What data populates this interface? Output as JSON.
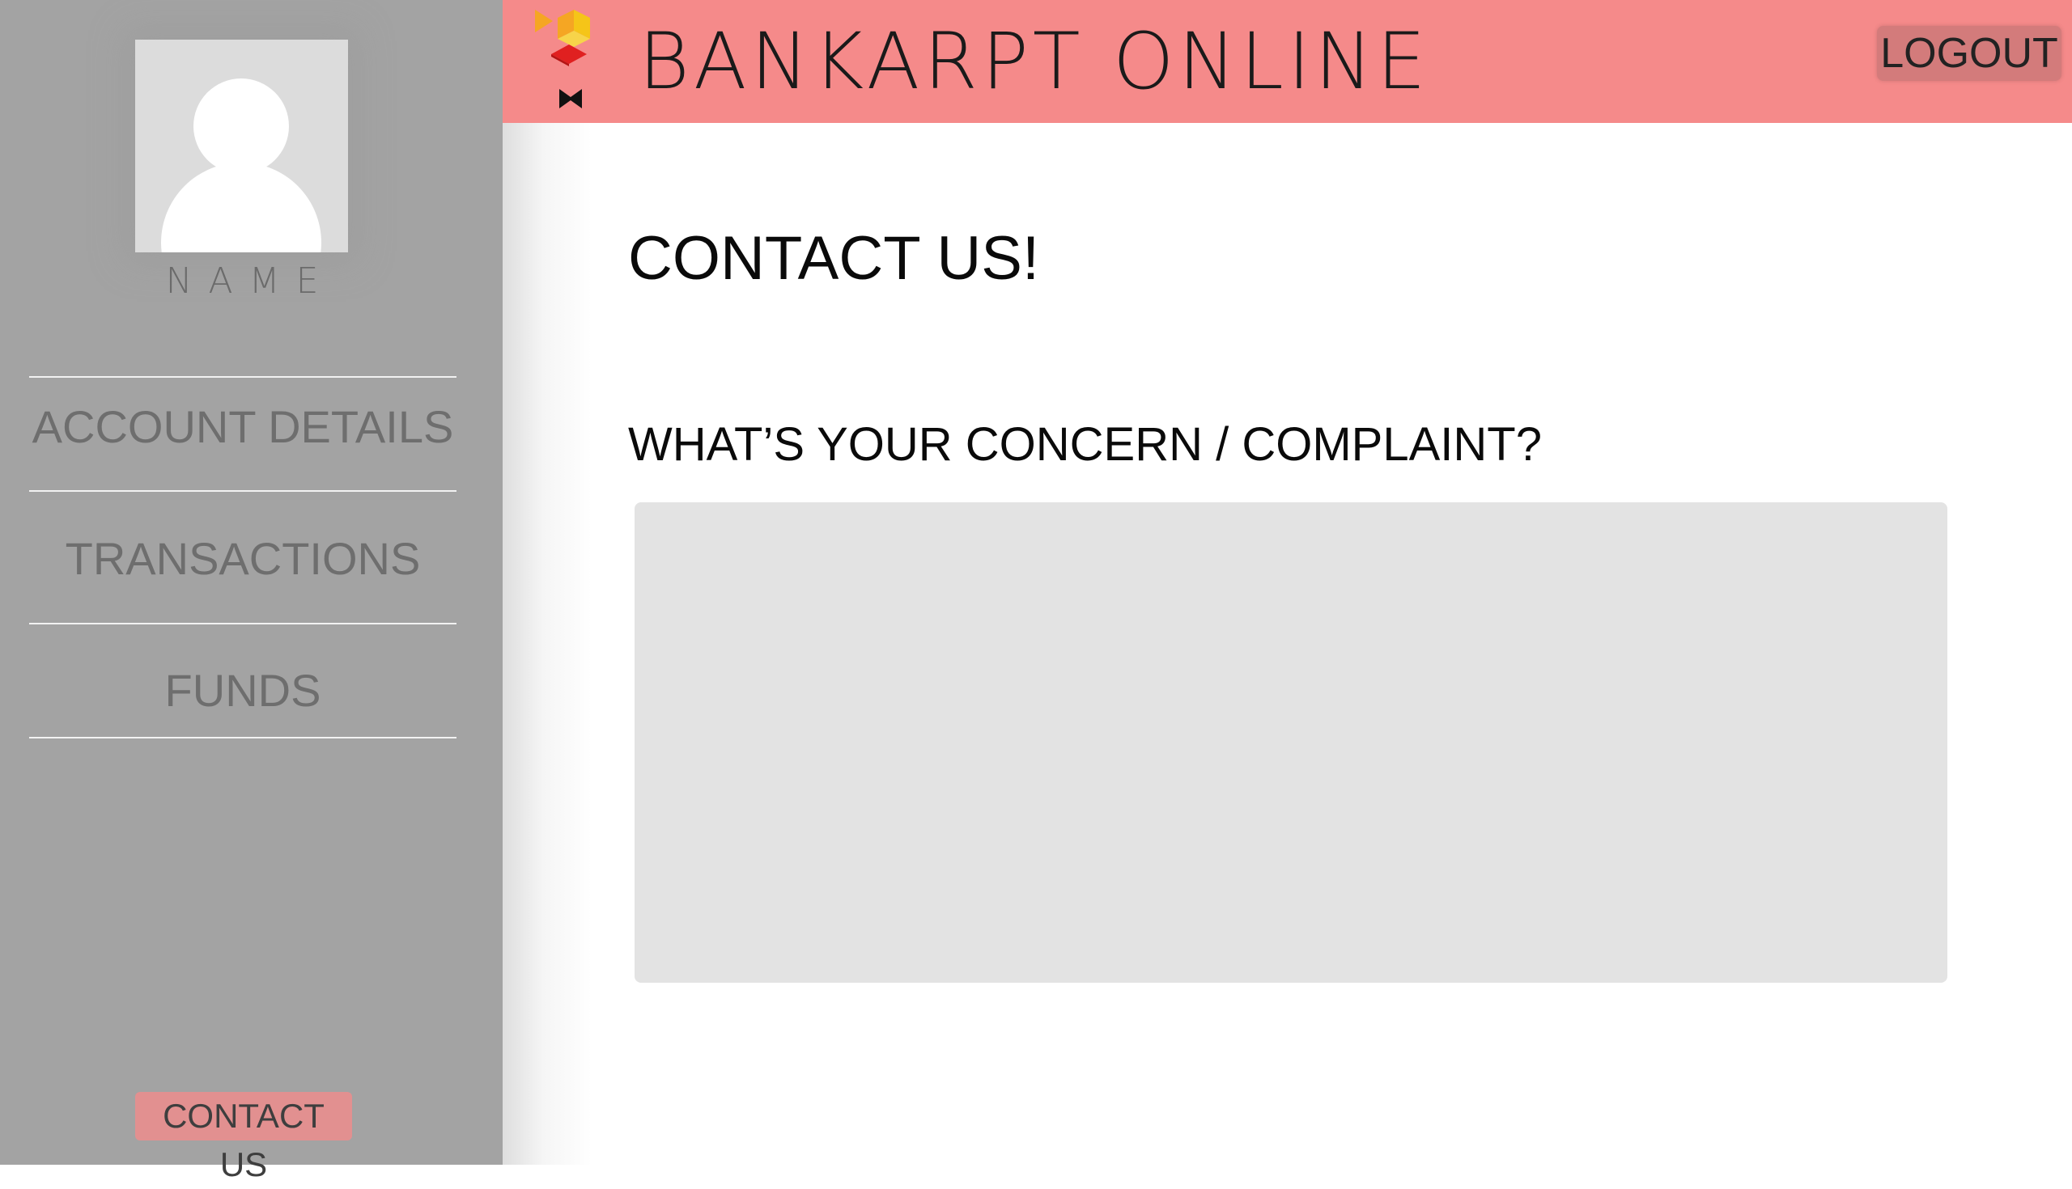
{
  "app": {
    "brand": "BANKARPT  ONLINE",
    "logo_icon": "geometric-bird-bowtie-logo"
  },
  "header": {
    "logout_label": "LOGOUT"
  },
  "sidebar": {
    "profile_name": "NAME",
    "avatar_icon": "user-silhouette-icon",
    "items": [
      {
        "label": "ACCOUNT DETAILS"
      },
      {
        "label": "TRANSACTIONS"
      },
      {
        "label": "FUNDS"
      }
    ],
    "contact_label": "CONTACT US"
  },
  "main": {
    "title": "CONTACT US!",
    "concern_label": "WHAT’S YOUR CONCERN / COMPLAINT?",
    "concern_value": "",
    "concern_placeholder": ""
  },
  "colors": {
    "header_bg": "#f58a8a",
    "sidebar_bg": "#a3a3a3",
    "contact_button_bg": "#e29090",
    "logout_button_bg": "#d37b7b",
    "textarea_bg": "#e3e3e3",
    "logo_yellow": "#f5c518",
    "logo_orange": "#f5a623",
    "logo_red": "#e02020",
    "logo_black": "#111111"
  }
}
